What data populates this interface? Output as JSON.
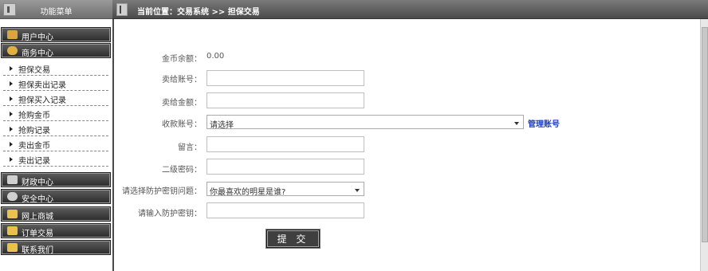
{
  "sidebar": {
    "title": "功能菜单",
    "categories": [
      {
        "label": "用户中心",
        "icon": "user-folder-icon",
        "color": "#d9a441"
      },
      {
        "label": "商务中心",
        "icon": "business-icon",
        "color": "#e0b040"
      },
      {
        "label": "财政中心",
        "icon": "finance-icon",
        "color": "#cfcfcf"
      },
      {
        "label": "安全中心",
        "icon": "security-icon",
        "color": "#cfcfcf"
      },
      {
        "label": "网上商城",
        "icon": "folder-icon",
        "color": "#e8c24a"
      },
      {
        "label": "订单交易",
        "icon": "folder-icon",
        "color": "#e8c24a"
      },
      {
        "label": "联系我们",
        "icon": "folder-icon",
        "color": "#e8c24a"
      }
    ],
    "sub_items": [
      {
        "label": "担保交易"
      },
      {
        "label": "担保卖出记录"
      },
      {
        "label": "担保买入记录"
      },
      {
        "label": "抢购金币"
      },
      {
        "label": "抢购记录"
      },
      {
        "label": "卖出金币"
      },
      {
        "label": "卖出记录"
      }
    ]
  },
  "topbar": {
    "breadcrumb": "当前位置：交易系统 >> 担保交易"
  },
  "form": {
    "balance_label": "金币余额：",
    "balance_value": "0.00",
    "sell_account_label": "卖给账号：",
    "sell_account_value": "",
    "sell_amount_label": "卖给金额：",
    "sell_amount_value": "",
    "receive_account_label": "收款账号：",
    "receive_account_selected": "请选择",
    "manage_account_link": "管理账号",
    "message_label": "留言：",
    "message_value": "",
    "second_password_label": "二级密码：",
    "second_password_value": "",
    "security_question_label": "请选择防护密钥问题：",
    "security_question_selected": "你最喜欢的明星是谁?",
    "security_answer_label": "请输入防护密钥：",
    "security_answer_value": "",
    "submit_label": "提 交"
  }
}
